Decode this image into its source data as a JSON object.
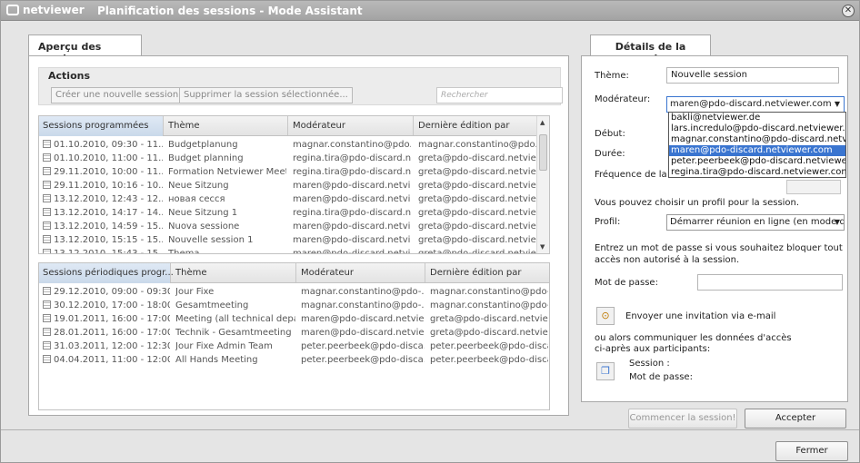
{
  "titlebar": {
    "app": "netviewer",
    "title": "Planification des sessions - Mode Assistant"
  },
  "left": {
    "tab": "Aperçu des sessions",
    "actions": {
      "label": "Actions",
      "create": "Créer une nouvelle session...",
      "delete": "Supprimer la session sélectionnée...",
      "search_placeholder": "Rechercher"
    },
    "scheduled": {
      "columns": [
        "Sessions programmées",
        "Thème",
        "Modérateur",
        "Dernière édition par"
      ],
      "rows": [
        [
          "01.10.2010, 09:30 - 11...",
          "Budgetplanung",
          "magnar.constantino@pdo...",
          "magnar.constantino@pdo..."
        ],
        [
          "01.10.2010, 11:00 - 11...",
          "Budget planning",
          "regina.tira@pdo-discard.n...",
          "greta@pdo-discard.netvie..."
        ],
        [
          "29.11.2010, 10:00 - 11...",
          "Formation Netviewer Meet",
          "regina.tira@pdo-discard.n...",
          "greta@pdo-discard.netvie..."
        ],
        [
          "29.11.2010, 10:16 - 10...",
          "Neue Sitzung",
          "maren@pdo-discard.netvi...",
          "greta@pdo-discard.netvie..."
        ],
        [
          "13.12.2010, 12:43 - 12...",
          "новая сесся",
          "maren@pdo-discard.netvi...",
          "greta@pdo-discard.netvie..."
        ],
        [
          "13.12.2010, 14:17 - 14...",
          "Neue Sitzung 1",
          "regina.tira@pdo-discard.n...",
          "greta@pdo-discard.netvie..."
        ],
        [
          "13.12.2010, 14:59 - 15...",
          "Nuova sessione",
          "maren@pdo-discard.netvi...",
          "greta@pdo-discard.netvie..."
        ],
        [
          "13.12.2010, 15:15 - 15...",
          "Nouvelle session 1",
          "maren@pdo-discard.netvi...",
          "greta@pdo-discard.netvie..."
        ],
        [
          "13.12.2010, 15:43 - 15...",
          "Thema",
          "maren@pdo-discard.netvi...",
          "greta@pdo-discard.netvie..."
        ]
      ]
    },
    "periodic": {
      "columns": [
        "Sessions périodiques progr...",
        "Thème",
        "Modérateur",
        "Dernière édition par"
      ],
      "rows": [
        [
          "29.12.2010, 09:00 - 09:30",
          "Jour Fixe",
          "magnar.constantino@pdo-...",
          "magnar.constantino@pdo-..."
        ],
        [
          "30.12.2010, 17:00 - 18:00",
          "Gesamtmeeting",
          "magnar.constantino@pdo-...",
          "magnar.constantino@pdo-..."
        ],
        [
          "19.01.2011, 16:00 - 17:00",
          "Meeting (all technical depar...",
          "maren@pdo-discard.netvie...",
          "greta@pdo-discard.netvie..."
        ],
        [
          "28.01.2011, 16:00 - 17:00",
          "Technik - Gesamtmeeting",
          "maren@pdo-discard.netvie...",
          "greta@pdo-discard.netvie..."
        ],
        [
          "31.03.2011, 12:00 - 12:30",
          "Jour Fixe Admin Team",
          "peter.peerbeek@pdo-disca...",
          "peter.peerbeek@pdo-disca..."
        ],
        [
          "04.04.2011, 11:00 - 12:00",
          "All Hands Meeting",
          "peter.peerbeek@pdo-disca...",
          "peter.peerbeek@pdo-disca..."
        ]
      ]
    }
  },
  "right": {
    "tab": "Détails de la session",
    "theme_label": "Thème:",
    "theme_value": "Nouvelle session",
    "moderator_label": "Modérateur:",
    "moderator_value": "maren@pdo-discard.netviewer.com",
    "moderator_options": [
      "bakli@netviewer.de",
      "lars.incredulo@pdo-discard.netviewer.com",
      "magnar.constantino@pdo-discard.netviewer",
      "maren@pdo-discard.netviewer.com",
      "peter.peerbeek@pdo-discard.netviewer.com",
      "regina.tira@pdo-discard.netviewer.com"
    ],
    "start_label": "Début:",
    "duration_label": "Durée:",
    "frequency_label": "Fréquence de la se",
    "profile_intro": "Vous pouvez choisir un profil pour la session.",
    "profile_label": "Profil:",
    "profile_value": "Démarrer réunion en ligne (en mode de",
    "password_intro_1": "Entrez un mot de passe si vous souhaitez bloquer tout",
    "password_intro_2": "accès non autorisé à la session.",
    "password_label": "Mot de passe:",
    "invite_text": "Envoyer une invitation via e-mail",
    "or_text_1": "ou alors communiquer les données d'accès",
    "or_text_2": "ci-après aux participants:",
    "session_label": "Session :",
    "pw_label2": "Mot de passe:",
    "start_button": "Commencer la session!",
    "accept_button": "Accepter"
  },
  "footer": {
    "close_button": "Fermer"
  },
  "colors": {
    "accent_selected": "#3a75d0"
  }
}
